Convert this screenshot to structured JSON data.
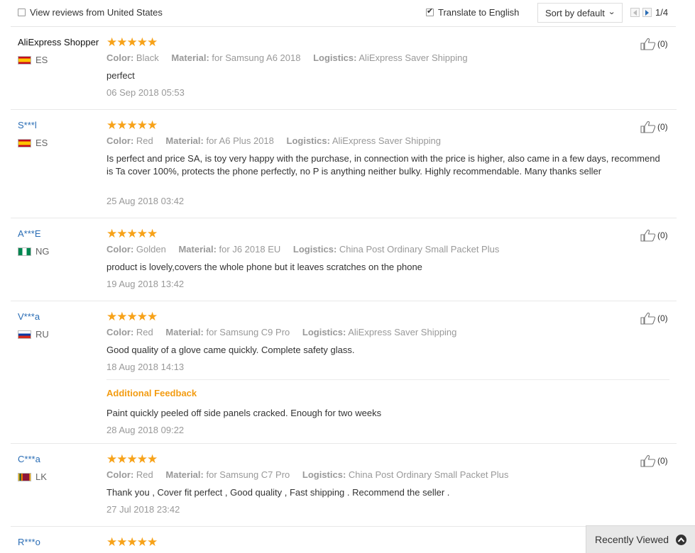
{
  "filters": {
    "country_label": "View reviews from United States",
    "country_checked": false,
    "translate_label": "Translate to English",
    "translate_checked": true
  },
  "sort": {
    "selected": "Sort by default"
  },
  "pagination": {
    "current": "1/4"
  },
  "labels": {
    "color": "Color:",
    "material": "Material:",
    "logistics": "Logistics:",
    "additional_feedback": "Additional Feedback"
  },
  "star_color": "#f7a219",
  "link_color": "#2a6db5",
  "reviews": [
    {
      "name": "AliExpress Shopper",
      "country": "ES",
      "rating": 5,
      "stars": "★★★★★",
      "color": "Black",
      "material": "for Samsung A6 2018",
      "logistics": "AliExpress Saver Shipping",
      "text": "perfect",
      "date": "06 Sep 2018 05:53",
      "likes": "(0)"
    },
    {
      "name": "S***l",
      "country": "ES",
      "rating": 5,
      "stars": "★★★★★",
      "color": "Red",
      "material": "for A6 Plus 2018",
      "logistics": "AliExpress Saver Shipping",
      "text": "Is perfect and price SA, is toy very happy with the purchase, in connection with the price is higher, also came in a few days, recommend is Ta cover 100%, protects the phone perfectly, no P is anything neither bulky. Highly recommendable. Many thanks seller",
      "date": "25 Aug 2018 03:42",
      "likes": "(0)"
    },
    {
      "name": "A***E",
      "country": "NG",
      "rating": 5,
      "stars": "★★★★★",
      "color": "Golden",
      "material": "for J6 2018 EU",
      "logistics": "China Post Ordinary Small Packet Plus",
      "text": "product is lovely,covers the whole phone but it leaves scratches on the phone",
      "date": "19 Aug 2018 13:42",
      "likes": "(0)"
    },
    {
      "name": "V***a",
      "country": "RU",
      "rating": 5,
      "stars": "★★★★★",
      "color": "Red",
      "material": "for Samsung C9 Pro",
      "logistics": "AliExpress Saver Shipping",
      "text": "Good quality of a glove came quickly. Complete safety glass.",
      "date": "18 Aug 2018 14:13",
      "likes": "(0)",
      "additional_text": "Paint quickly peeled off side panels cracked. Enough for two weeks",
      "additional_date": "28 Aug 2018 09:22"
    },
    {
      "name": "C***a",
      "country": "LK",
      "rating": 5,
      "stars": "★★★★★",
      "color": "Red",
      "material": "for Samsung C7 Pro",
      "logistics": "China Post Ordinary Small Packet Plus",
      "text": "Thank you , Cover fit perfect , Good quality , Fast shipping . Recommend the seller .",
      "date": "27 Jul 2018 23:42",
      "likes": "(0)"
    },
    {
      "name": "R***o",
      "rating": 5,
      "stars": "★★★★★"
    }
  ],
  "recently_viewed": {
    "label": "Recently Viewed"
  }
}
